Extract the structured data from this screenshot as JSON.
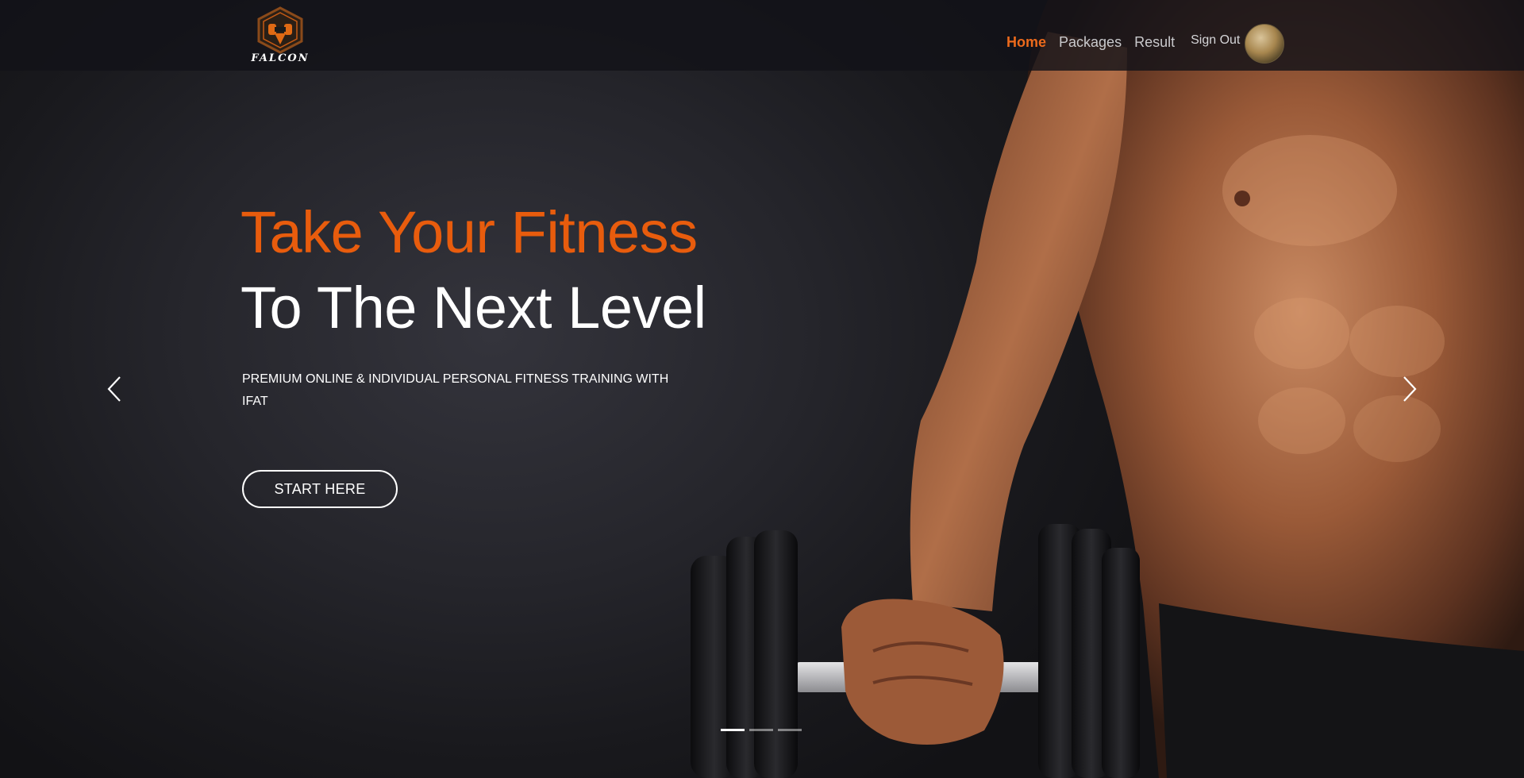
{
  "brand": {
    "name": "FALCON"
  },
  "nav": {
    "items": [
      {
        "label": "Home",
        "active": true
      },
      {
        "label": "Packages",
        "active": false
      },
      {
        "label": "Result",
        "active": false
      }
    ],
    "signout_label": "Sign Out"
  },
  "hero": {
    "headline_line1": "Take Your Fitness",
    "headline_line2": "To The Next Level",
    "subtext": "PREMIUM ONLINE & INDIVIDUAL PERSONAL FITNESS TRAINING WITH IFAT",
    "cta_label": "START HERE"
  },
  "carousel": {
    "slide_count": 3,
    "active_index": 0,
    "prev_icon": "chevron-left-icon",
    "next_icon": "chevron-right-icon"
  },
  "colors": {
    "accent": "#e85c0d",
    "nav_active": "#ec6a1c",
    "text": "#ffffff",
    "background": "#1c1c21"
  }
}
